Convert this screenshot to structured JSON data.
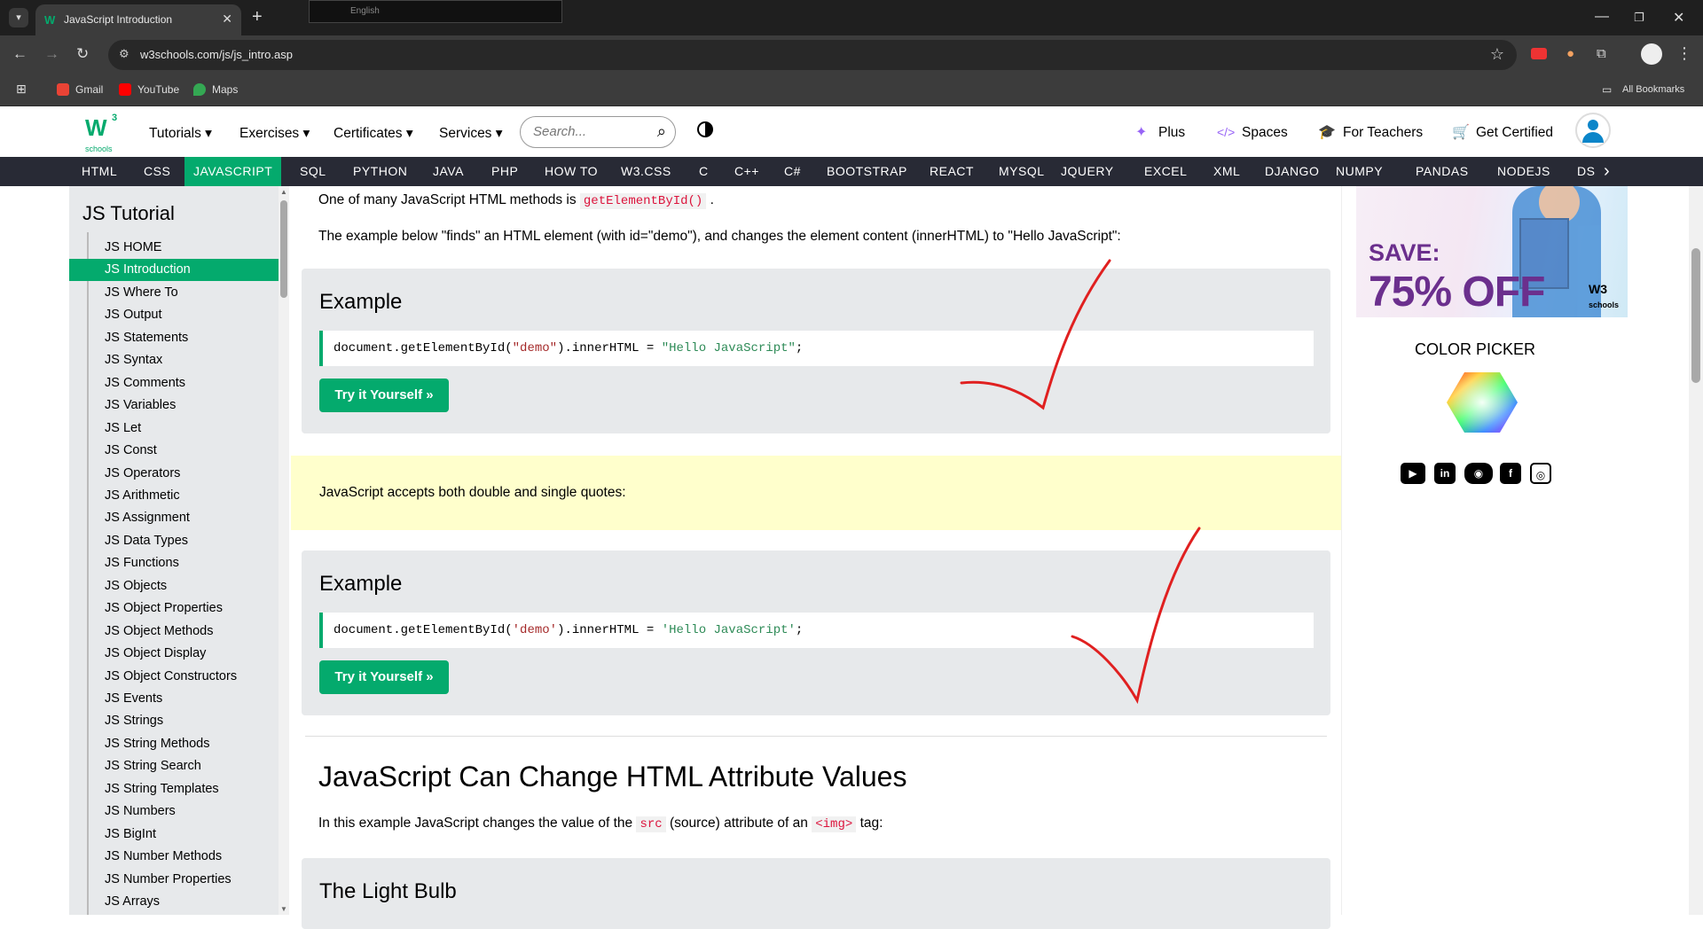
{
  "browser": {
    "tab_title": "JavaScript Introduction",
    "url": "w3schools.com/js/js_intro.asp",
    "lang_label": "English",
    "bookmarks": [
      "Gmail",
      "YouTube",
      "Maps"
    ],
    "all_bookmarks": "All Bookmarks"
  },
  "topnav": {
    "menus": [
      "Tutorials ▾",
      "Exercises ▾",
      "Certificates ▾",
      "Services ▾"
    ],
    "search_placeholder": "Search...",
    "right_links": [
      "Plus",
      "Spaces",
      "For Teachers",
      "Get Certified"
    ]
  },
  "subjects": [
    "HTML",
    "CSS",
    "JAVASCRIPT",
    "SQL",
    "PYTHON",
    "JAVA",
    "PHP",
    "HOW TO",
    "W3.CSS",
    "C",
    "C++",
    "C#",
    "BOOTSTRAP",
    "REACT",
    "MYSQL",
    "JQUERY",
    "EXCEL",
    "XML",
    "DJANGO",
    "NUMPY",
    "PANDAS",
    "NODEJS",
    "DS"
  ],
  "sidebar": {
    "title": "JS Tutorial",
    "items": [
      "JS HOME",
      "JS Introduction",
      "JS Where To",
      "JS Output",
      "JS Statements",
      "JS Syntax",
      "JS Comments",
      "JS Variables",
      "JS Let",
      "JS Const",
      "JS Operators",
      "JS Arithmetic",
      "JS Assignment",
      "JS Data Types",
      "JS Functions",
      "JS Objects",
      "JS Object Properties",
      "JS Object Methods",
      "JS Object Display",
      "JS Object Constructors",
      "JS Events",
      "JS Strings",
      "JS String Methods",
      "JS String Search",
      "JS String Templates",
      "JS Numbers",
      "JS BigInt",
      "JS Number Methods",
      "JS Number Properties",
      "JS Arrays"
    ]
  },
  "main": {
    "intro_prefix": "One of many JavaScript HTML methods is",
    "intro_code": "getElementById()",
    "intro_suffix": ".",
    "finds_text": "The example below \"finds\" an HTML element (with id=\"demo\"), and changes the element content (innerHTML) to \"Hello JavaScript\":",
    "example_title": "Example",
    "code1_a": "document.getElementById(",
    "code1_b": "\"demo\"",
    "code1_c": ").innerHTML = ",
    "code1_d": "\"Hello JavaScript\"",
    "code1_e": ";",
    "try_label": "Try it Yourself »",
    "note_text": "JavaScript accepts both double and single quotes:",
    "code2_a": "document.getElementById(",
    "code2_b": "'demo'",
    "code2_c": ").innerHTML = ",
    "code2_d": "'Hello JavaScript'",
    "code2_e": ";",
    "heading2": "JavaScript Can Change HTML Attribute Values",
    "attr_prefix": "In this example JavaScript changes the value of the",
    "attr_code1": "src",
    "attr_mid": "(source) attribute of an",
    "attr_code2": "<img>",
    "attr_suffix": "tag:",
    "bulb_title": "The Light Bulb"
  },
  "right": {
    "ad_save": "SAVE:",
    "ad_off": "75% OFF",
    "ad_brand": "W3",
    "ad_brand_sub": "schools",
    "color_picker": "COLOR PICKER"
  },
  "colors": {
    "brand_green": "#04aa6d",
    "subject_bar": "#282a35",
    "note_bg": "#ffffcc",
    "check_marks": "#e02020"
  }
}
